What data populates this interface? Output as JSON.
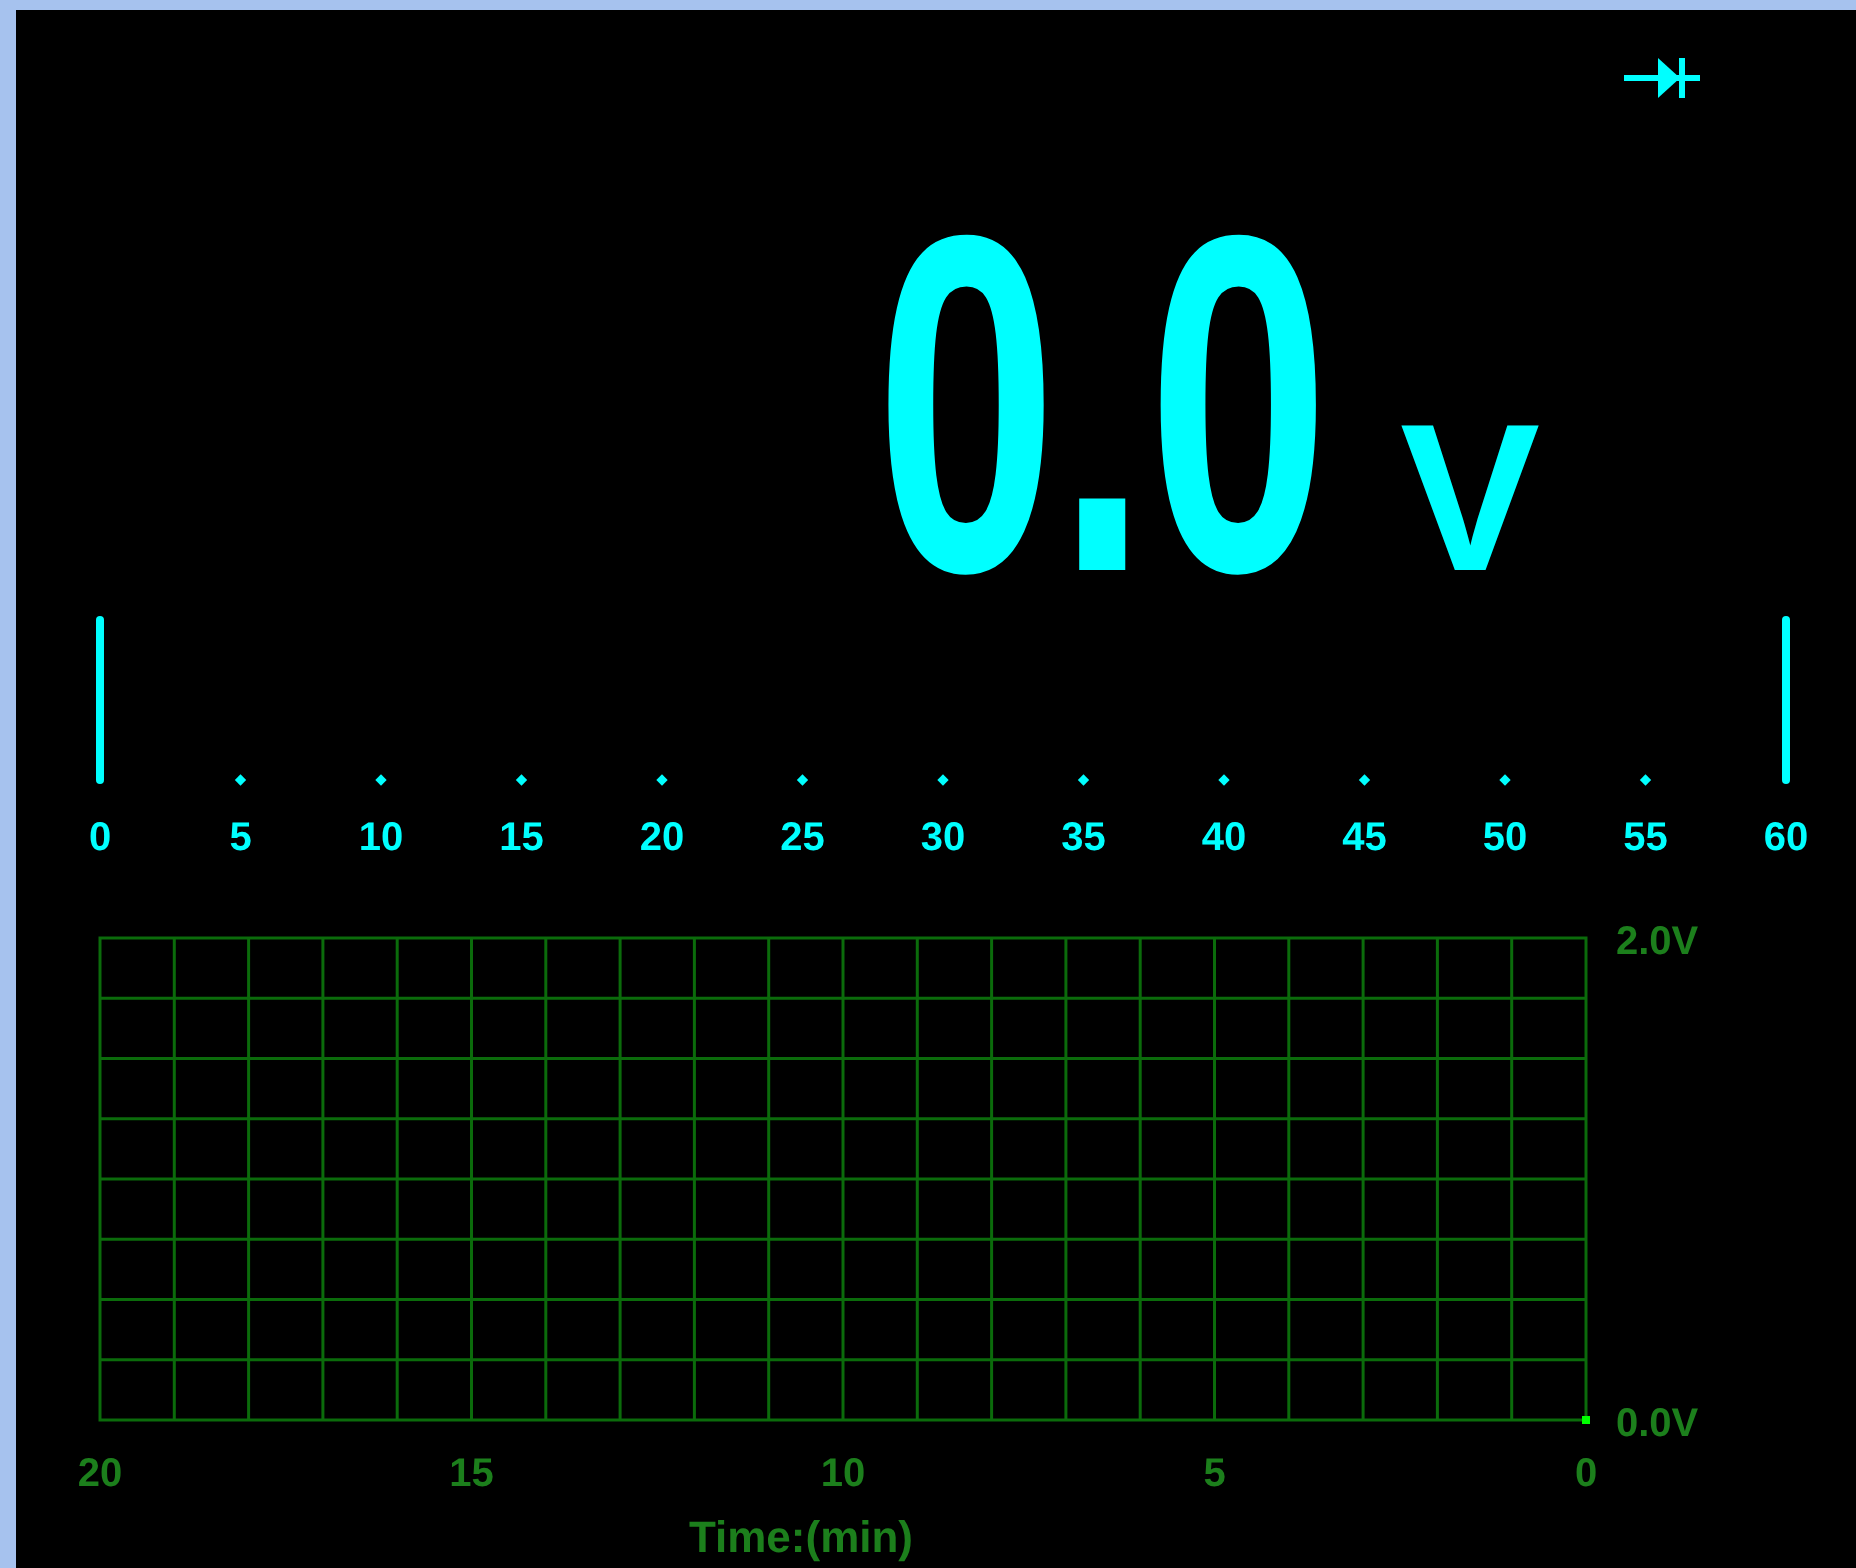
{
  "reading": {
    "value": "0.0",
    "unit": "V"
  },
  "bar_scale": {
    "labels": [
      "0",
      "5",
      "10",
      "15",
      "20",
      "25",
      "30",
      "35",
      "40",
      "45",
      "50",
      "55",
      "60"
    ]
  },
  "trend": {
    "chart_data": {
      "type": "line",
      "grid": true,
      "xlabel": "Time:(min)",
      "xlim": [
        20,
        0
      ],
      "ylim": [
        0,
        2
      ],
      "xticks": [
        20,
        15,
        10,
        5,
        0
      ],
      "yticks": [
        {
          "value": 0,
          "label": "0.0V"
        },
        {
          "value": 2,
          "label": "2.0V"
        }
      ],
      "x": [
        0
      ],
      "series": [
        {
          "color": "#00ff00",
          "marker": "square",
          "values": [
            0
          ]
        }
      ]
    }
  }
}
